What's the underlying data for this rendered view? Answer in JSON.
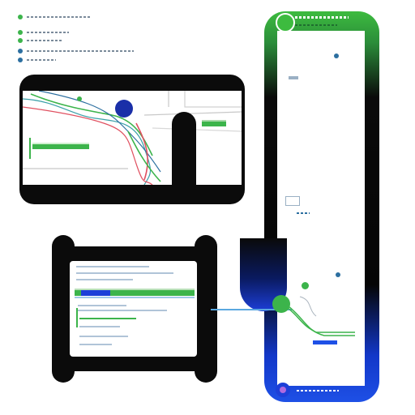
{
  "legend": {
    "items": [
      {
        "color": "#3cb44b",
        "icon": "green-dot-icon"
      },
      {
        "color": "#3cb44b",
        "icon": "green-dot-icon"
      },
      {
        "color": "#2c6fa0",
        "icon": "blue-dot-icon"
      },
      {
        "color": "#2c6fa0",
        "icon": "blue-dot-icon"
      }
    ]
  },
  "colors": {
    "accent_green": "#3cb44b",
    "accent_blue": "#1e50e6",
    "frame": "#0b0b0b",
    "route_red": "#e05060",
    "route_teal": "#3aa0a8"
  },
  "icons": {
    "phone_header": "green-circle-icon",
    "phone_footer": "purple-dot-icon",
    "map_marker": "blue-circle-icon",
    "connector": "green-circle-icon"
  }
}
